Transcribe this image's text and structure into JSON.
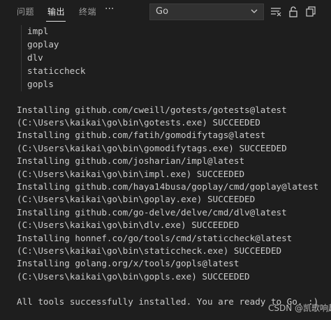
{
  "tabs": [
    "问题",
    "输出",
    "终端"
  ],
  "more_label": "···",
  "output_channel": "Go",
  "tools": [
    "impl",
    "goplay",
    "dlv",
    "staticcheck",
    "gopls"
  ],
  "log": [
    "Installing github.com/cweill/gotests/gotests@latest",
    "(C:\\Users\\kaikai\\go\\bin\\gotests.exe) SUCCEEDED",
    "Installing github.com/fatih/gomodifytags@latest",
    "(C:\\Users\\kaikai\\go\\bin\\gomodifytags.exe) SUCCEEDED",
    "Installing github.com/josharian/impl@latest",
    "(C:\\Users\\kaikai\\go\\bin\\impl.exe) SUCCEEDED",
    "Installing github.com/haya14busa/goplay/cmd/goplay@latest",
    "(C:\\Users\\kaikai\\go\\bin\\goplay.exe) SUCCEEDED",
    "Installing github.com/go-delve/delve/cmd/dlv@latest",
    "(C:\\Users\\kaikai\\go\\bin\\dlv.exe) SUCCEEDED",
    "Installing honnef.co/go/tools/cmd/staticcheck@latest",
    "(C:\\Users\\kaikai\\go\\bin\\staticcheck.exe) SUCCEEDED",
    "Installing golang.org/x/tools/gopls@latest",
    "(C:\\Users\\kaikai\\go\\bin\\gopls.exe) SUCCEEDED"
  ],
  "final_message": "All tools successfully installed. You are ready to Go. :)",
  "watermark": "CSDN @凯歌响起",
  "icons": [
    "filter-lines-icon",
    "lock-icon",
    "copy-icon"
  ],
  "colors": {
    "background": "#1e1e1e",
    "text": "#cccccc",
    "active_tab": "#e7e7e7"
  }
}
